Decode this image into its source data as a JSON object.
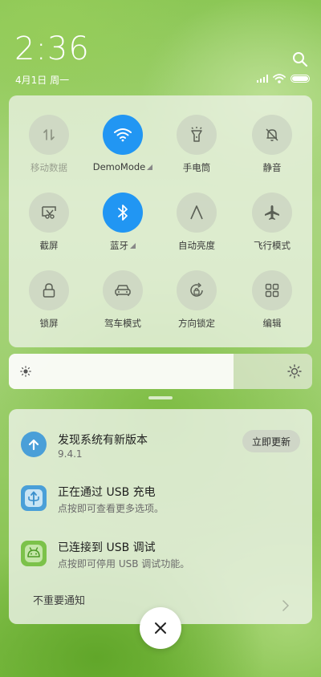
{
  "status": {
    "time": "2:36",
    "date": "4月1日 周一"
  },
  "toggles": [
    {
      "label": "移动数据",
      "on": false,
      "icon": "mobile-data-icon"
    },
    {
      "label": "DemoMode",
      "on": true,
      "icon": "wifi-icon"
    },
    {
      "label": "手电筒",
      "on": false,
      "icon": "flashlight-icon"
    },
    {
      "label": "静音",
      "on": false,
      "icon": "mute-bell-icon"
    },
    {
      "label": "截屏",
      "on": false,
      "icon": "screenshot-icon"
    },
    {
      "label": "蓝牙",
      "on": true,
      "icon": "bluetooth-icon"
    },
    {
      "label": "自动亮度",
      "on": false,
      "icon": "auto-brightness-icon"
    },
    {
      "label": "飞行模式",
      "on": false,
      "icon": "airplane-icon"
    },
    {
      "label": "锁屏",
      "on": false,
      "icon": "lock-icon"
    },
    {
      "label": "驾车模式",
      "on": false,
      "icon": "car-icon"
    },
    {
      "label": "方向锁定",
      "on": false,
      "icon": "rotation-lock-icon"
    },
    {
      "label": "编辑",
      "on": false,
      "icon": "grid-icon"
    }
  ],
  "brightness": {
    "level": 0.74
  },
  "notifications": [
    {
      "title": "发现系统有新版本",
      "body": "9.4.1",
      "action": "立即更新",
      "icon": "update-arrow-icon",
      "color": "#4a9fd8"
    },
    {
      "title": "正在通过 USB 充电",
      "body": "点按即可查看更多选项。",
      "icon": "usb-icon",
      "color": "#4a9fd8"
    },
    {
      "title": "已连接到 USB 调试",
      "body": "点按即可停用 USB 调试功能。",
      "icon": "android-icon",
      "color": "#7cc24a"
    }
  ],
  "unimportant_label": "不重要通知",
  "accent": "#2196f3"
}
